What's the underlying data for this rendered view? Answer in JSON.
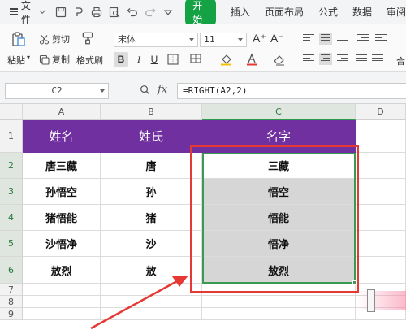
{
  "menubar": {
    "file_label": "文件",
    "tabs": [
      "开始",
      "插入",
      "页面布局",
      "公式",
      "数据",
      "审阅"
    ],
    "active_tab_color": "#14a244"
  },
  "ribbon": {
    "paste_label": "粘贴",
    "cut_label": "剪切",
    "copy_label": "复制",
    "format_painter_label": "格式刷",
    "font_name": "宋体",
    "font_size": "11",
    "bold_label": "B",
    "italic_label": "I",
    "underline_label": "U",
    "font_grow_label": "A⁺",
    "font_shrink_label": "A⁻",
    "merge_label": "合"
  },
  "formula_bar": {
    "name_box": "C2",
    "fx_label": "fx",
    "formula": "=RIGHT(A2,2)"
  },
  "sheet": {
    "columns": [
      "A",
      "B",
      "C",
      "D"
    ],
    "rows": [
      "1",
      "2",
      "3",
      "4",
      "5",
      "6",
      "7",
      "8",
      "9"
    ],
    "header_row": [
      "姓名",
      "姓氏",
      "名字"
    ],
    "header_color": "#7030a0",
    "data": [
      [
        "唐三藏",
        "唐",
        "三藏"
      ],
      [
        "孙悟空",
        "孙",
        "悟空"
      ],
      [
        "猪悟能",
        "猪",
        "悟能"
      ],
      [
        "沙悟净",
        "沙",
        "悟净"
      ],
      [
        "敖烈",
        "敖",
        "敖烈"
      ]
    ],
    "selected_range": "C2:C6",
    "annotation_color": "#e53935"
  }
}
